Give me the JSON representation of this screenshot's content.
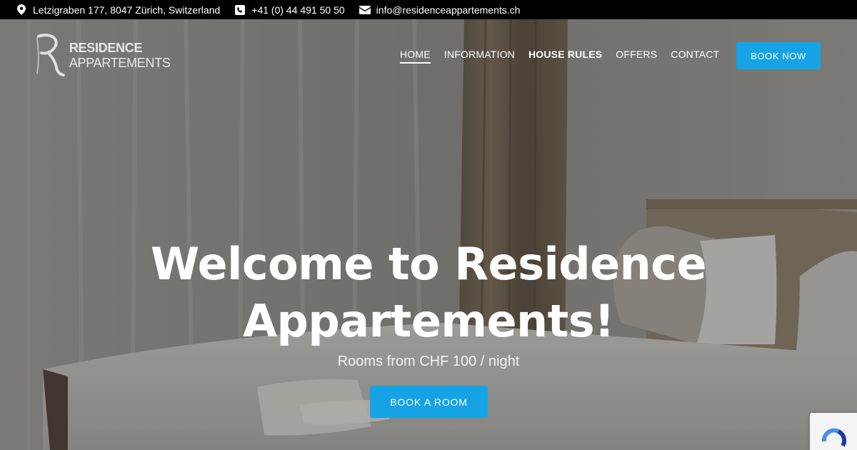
{
  "topbar": {
    "address": "Letzigraben 177, 8047 Zürich, Switzerland",
    "phone": "+41 (0) 44 491 50 50",
    "email": "info@residenceappartements.ch"
  },
  "logo": {
    "brand_bold": "RESIDENCE",
    "brand_rest": "APPARTEMENTS"
  },
  "nav": {
    "items": [
      {
        "label": "HOME"
      },
      {
        "label": "INFORMATION"
      },
      {
        "label": "HOUSE RULES"
      },
      {
        "label": "OFFERS"
      },
      {
        "label": "CONTACT"
      }
    ],
    "book_now": "BOOK NOW"
  },
  "hero": {
    "title_line1": "Welcome to Residence",
    "title_line2": "Appartements!",
    "subtitle": "Rooms from CHF 100 / night",
    "cta": "BOOK A ROOM"
  },
  "colors": {
    "accent": "#15a3e6",
    "topbar_bg": "#000000"
  }
}
